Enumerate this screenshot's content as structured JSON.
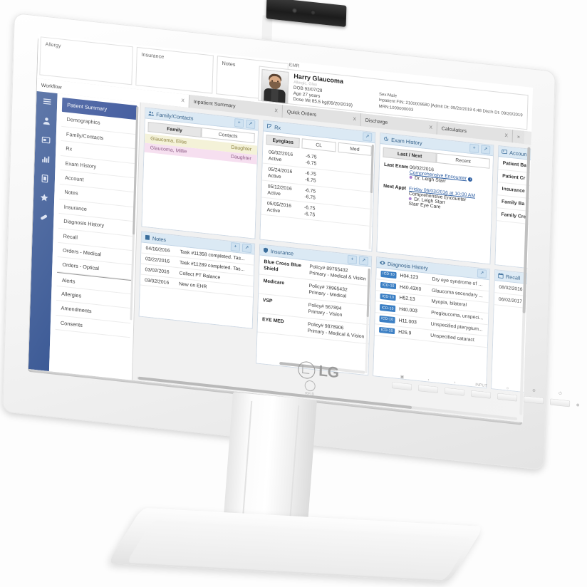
{
  "device": {
    "brand": "LG",
    "rfid_label": "RFID",
    "osd_buttons": [
      "menu",
      "left",
      "right",
      "INPUT",
      "brightness",
      "settings",
      "power",
      "led"
    ],
    "osd_input_label": "INPUT"
  },
  "screen": {
    "app_title": "EMR",
    "top_cards": [
      {
        "label": "Allergy"
      },
      {
        "label": "Insurance"
      },
      {
        "label": "Notes"
      }
    ],
    "patient": {
      "name": "Harry Glaucoma",
      "alias": "Allergic, Glau",
      "dob": "DOB 93/07/28",
      "age": "Age 27 years",
      "dose_wt": "Dose Wt 85.5 kg(09/20/2019)",
      "sex": "Sex:Male",
      "fin": "Inpatient FIN: 2100009580 [Admit Dt: 09/20/2019 6:48 Disch Dt: 09/20/2019",
      "mrn": "MRN:1000000003"
    },
    "tabs": [
      {
        "label": "Workflow",
        "close": "X",
        "active": true
      },
      {
        "label": "Inpatient Summary",
        "close": "X",
        "active": false
      },
      {
        "label": "Quick Orders",
        "close": "X",
        "active": false
      },
      {
        "label": "Discharge",
        "close": "X",
        "active": false
      },
      {
        "label": "Calculators",
        "close": "X",
        "active": false
      }
    ],
    "tabs_overflow": "»",
    "rail_icons": [
      "hamburger-menu-icon",
      "patient-icon",
      "card-icon",
      "chart-icon",
      "document-icon",
      "star-icon",
      "pill-icon"
    ],
    "workflow": {
      "items": [
        {
          "label": "Patient Summary",
          "selected": true
        },
        {
          "label": "Demographics",
          "selected": false
        },
        {
          "label": "Family/Contacts",
          "selected": false
        },
        {
          "label": "Rx",
          "selected": false
        },
        {
          "label": "Exam History",
          "selected": false
        },
        {
          "label": "Account",
          "selected": false
        },
        {
          "label": "Notes",
          "selected": false
        },
        {
          "label": "Insurance",
          "selected": false
        },
        {
          "label": "Diagnosis History",
          "selected": false
        },
        {
          "label": "Recall",
          "selected": false
        },
        {
          "label": "Orders - Medical",
          "selected": false
        },
        {
          "label": "Orders - Optical",
          "selected": false
        },
        {
          "label": "Alerts",
          "selected": false,
          "separator": true
        },
        {
          "label": "Allergies",
          "selected": false
        },
        {
          "label": "Amendments",
          "selected": false
        },
        {
          "label": "Consents",
          "selected": false
        }
      ]
    },
    "panels": {
      "family_contacts": {
        "title": "Family/Contacts",
        "icon": "people-icon",
        "add_label": "+",
        "expand_label": "↗",
        "tabs": [
          {
            "label": "Family",
            "on": true
          },
          {
            "label": "Contacts",
            "on": false
          }
        ],
        "rows": [
          {
            "name": "Glaucoma, Elise",
            "relation": "Daughter",
            "tone": "y"
          },
          {
            "name": "Glaucoma, Millie",
            "relation": "Daughter",
            "tone": "p"
          }
        ]
      },
      "rx": {
        "title": "Rx",
        "icon": "prescription-icon",
        "expand_label": "↗",
        "tabs": [
          {
            "label": "Eyeglass",
            "on": true
          },
          {
            "label": "CL",
            "on": false
          },
          {
            "label": "Med",
            "on": false
          }
        ],
        "rows": [
          {
            "date": "06/02/2016",
            "status": "Active",
            "od": "-6.75",
            "os": "-6.75"
          },
          {
            "date": "05/24/2016",
            "status": "Active",
            "od": "-6.75",
            "os": "-6.75"
          },
          {
            "date": "05/12/2016",
            "status": "Active",
            "od": "-6.75",
            "os": "-6.75"
          },
          {
            "date": "05/05/2016",
            "status": "Active",
            "od": "-6.75",
            "os": "-6.75"
          }
        ]
      },
      "exam_history": {
        "title": "Exam History",
        "icon": "history-icon",
        "add_label": "+",
        "expand_label": "↗",
        "tabs": [
          {
            "label": "Last / Next",
            "on": true
          },
          {
            "label": "Recent",
            "on": false
          }
        ],
        "last_exam_label": "Last Exam",
        "last_exam_date": "06/02/2016",
        "last_exam_type": "Comprehensive Encounter",
        "last_exam_provider": "Dr. Leigh Starr",
        "next_appt_label": "Next Appt",
        "next_appt_when": "Friday 06/03/2016 at 10:00 AM",
        "next_appt_type": "Comprehensive Encounter",
        "next_appt_provider": "Dr. Leigh Starr",
        "next_appt_location": "Starr Eye Care"
      },
      "account": {
        "title": "Accoun",
        "icon": "account-icon",
        "rows": [
          "Patient Ba",
          "Patient Cr",
          "Insurance",
          "Family Ba",
          "Family Cre"
        ]
      },
      "notes": {
        "title": "Notes",
        "icon": "note-icon",
        "add_label": "+",
        "expand_label": "↗",
        "rows": [
          {
            "date": "04/16/2016",
            "text": "Task #11358 completed. Tas..."
          },
          {
            "date": "03/22/2016",
            "text": "Task #11289 completed. Tas..."
          },
          {
            "date": "03/02/2016",
            "text": "Collect PT Balance"
          },
          {
            "date": "03/02/2016",
            "text": "New on EHR"
          }
        ]
      },
      "insurance": {
        "title": "Insurance",
        "icon": "shield-icon",
        "add_label": "+",
        "expand_label": "↗",
        "rows": [
          {
            "name": "Blue Cross Blue Shield",
            "policy": "Policy# 89765432",
            "plan": "Primary - Medical & Vision"
          },
          {
            "name": "Medicare",
            "policy": "Policy# 78965432",
            "plan": "Primary - Medical"
          },
          {
            "name": "VSP",
            "policy": "Policy# 567894",
            "plan": "Primary - Vision"
          },
          {
            "name": "EYE MED",
            "policy": "Policy# 9878906",
            "plan": "Primary - Medical & Vision"
          }
        ]
      },
      "diagnosis_history": {
        "title": "Diagnosis History",
        "icon": "eye-icon",
        "expand_label": "↗",
        "badge": "ICD-10",
        "rows": [
          {
            "code": "H04.123",
            "text": "Dry eye syndrome of b..."
          },
          {
            "code": "H40.43X0",
            "text": "Glaucoma secondary ..."
          },
          {
            "code": "H52.13",
            "text": "Myopia, bilateral"
          },
          {
            "code": "H40.003",
            "text": "Preglaucoma, unspeci..."
          },
          {
            "code": "H11.003",
            "text": "Unspecified pterygium..."
          },
          {
            "code": "H26.9",
            "text": "Unspecified cataract"
          }
        ]
      },
      "recall": {
        "title": "Recall",
        "icon": "calendar-icon",
        "rows": [
          "08/02/2016",
          "06/02/2017"
        ]
      }
    }
  }
}
